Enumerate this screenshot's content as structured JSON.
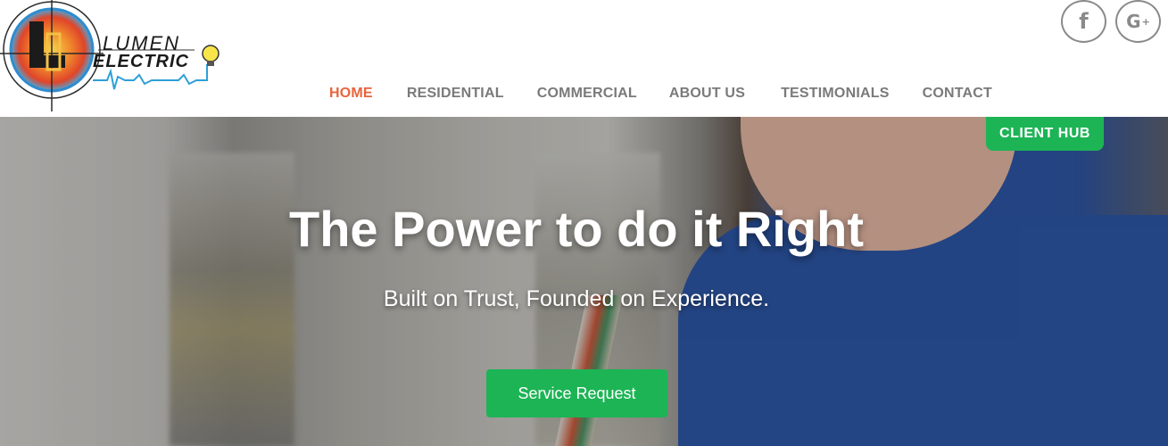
{
  "logo": {
    "line1": "LUMEN",
    "line2": "ELECTRIC",
    "monogram": "LE"
  },
  "social": [
    {
      "name": "facebook",
      "icon": "facebook-icon",
      "glyph": "f"
    },
    {
      "name": "google-plus",
      "icon": "google-plus-icon",
      "glyph": "G",
      "glyph_sup": "+"
    }
  ],
  "nav": {
    "items": [
      {
        "label": "HOME",
        "active": true
      },
      {
        "label": "RESIDENTIAL",
        "active": false
      },
      {
        "label": "COMMERCIAL",
        "active": false
      },
      {
        "label": "ABOUT US",
        "active": false
      },
      {
        "label": "TESTIMONIALS",
        "active": false
      },
      {
        "label": "CONTACT",
        "active": false
      }
    ]
  },
  "client_hub": {
    "label": "CLIENT HUB"
  },
  "hero": {
    "title": "The Power to do it Right",
    "subtitle": "Built on Trust, Founded on Experience.",
    "cta_label": "Service Request"
  },
  "colors": {
    "accent": "#e8643c",
    "nav_text": "#7a7a7a",
    "green": "#1db455",
    "white": "#ffffff"
  }
}
